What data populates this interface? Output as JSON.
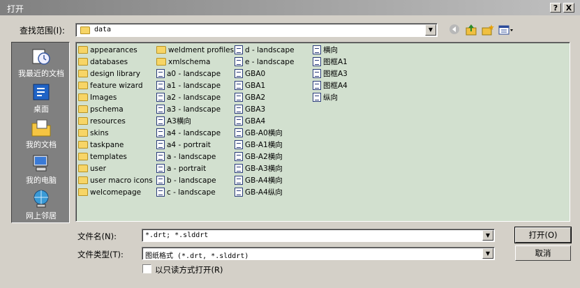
{
  "window": {
    "title": "打开",
    "help_button": "?",
    "close_button": "X"
  },
  "lookin": {
    "label": "查找范围(I):",
    "value": "data"
  },
  "toolbar": {
    "back": "back-icon",
    "up": "up-folder-icon",
    "new_folder": "new-folder-icon",
    "views": "views-menu-icon"
  },
  "places": [
    {
      "label": "我最近的文档",
      "icon": "recent-documents-icon"
    },
    {
      "label": "桌面",
      "icon": "desktop-icon"
    },
    {
      "label": "我的文档",
      "icon": "my-documents-icon"
    },
    {
      "label": "我的电脑",
      "icon": "my-computer-icon"
    },
    {
      "label": "网上邻居",
      "icon": "network-places-icon"
    }
  ],
  "columns": [
    [
      {
        "name": "appearances",
        "type": "folder"
      },
      {
        "name": "databases",
        "type": "folder"
      },
      {
        "name": "design library",
        "type": "folder"
      },
      {
        "name": "feature wizard",
        "type": "folder"
      },
      {
        "name": "Images",
        "type": "folder"
      },
      {
        "name": "pschema",
        "type": "folder"
      },
      {
        "name": "resources",
        "type": "folder"
      },
      {
        "name": "skins",
        "type": "folder"
      },
      {
        "name": "taskpane",
        "type": "folder"
      },
      {
        "name": "templates",
        "type": "folder"
      },
      {
        "name": "user",
        "type": "folder"
      },
      {
        "name": "user macro icons",
        "type": "folder"
      },
      {
        "name": "welcomepage",
        "type": "folder"
      }
    ],
    [
      {
        "name": "weldment profiles",
        "type": "folder"
      },
      {
        "name": "xmlschema",
        "type": "folder"
      },
      {
        "name": "a0 - landscape",
        "type": "file"
      },
      {
        "name": "a1 - landscape",
        "type": "file"
      },
      {
        "name": "a2 - landscape",
        "type": "file"
      },
      {
        "name": "a3 - landscape",
        "type": "file"
      },
      {
        "name": "A3横向",
        "type": "file"
      },
      {
        "name": "a4 - landscape",
        "type": "file"
      },
      {
        "name": "a4 - portrait",
        "type": "file"
      },
      {
        "name": "a - landscape",
        "type": "file"
      },
      {
        "name": "a - portrait",
        "type": "file"
      },
      {
        "name": "b - landscape",
        "type": "file"
      },
      {
        "name": "c - landscape",
        "type": "file"
      }
    ],
    [
      {
        "name": "d - landscape",
        "type": "file"
      },
      {
        "name": "e - landscape",
        "type": "file"
      },
      {
        "name": "GBA0",
        "type": "file"
      },
      {
        "name": "GBA1",
        "type": "file"
      },
      {
        "name": "GBA2",
        "type": "file"
      },
      {
        "name": "GBA3",
        "type": "file"
      },
      {
        "name": "GBA4",
        "type": "file"
      },
      {
        "name": "GB-A0横向",
        "type": "file"
      },
      {
        "name": "GB-A1横向",
        "type": "file"
      },
      {
        "name": "GB-A2横向",
        "type": "file"
      },
      {
        "name": "GB-A3横向",
        "type": "file"
      },
      {
        "name": "GB-A4横向",
        "type": "file"
      },
      {
        "name": "GB-A4纵向",
        "type": "file"
      }
    ],
    [
      {
        "name": "横向",
        "type": "file"
      },
      {
        "name": "图框A1",
        "type": "file"
      },
      {
        "name": "图框A3",
        "type": "file"
      },
      {
        "name": "图框A4",
        "type": "file"
      },
      {
        "name": "纵向",
        "type": "file"
      }
    ]
  ],
  "filename": {
    "label": "文件名(N):",
    "value": "*.drt; *.slddrt"
  },
  "filetype": {
    "label": "文件类型(T):",
    "value": "图纸格式 (*.drt, *.slddrt)"
  },
  "readonly": {
    "label": "以只读方式打开(R)"
  },
  "buttons": {
    "open": "打开(O)",
    "cancel": "取消"
  }
}
